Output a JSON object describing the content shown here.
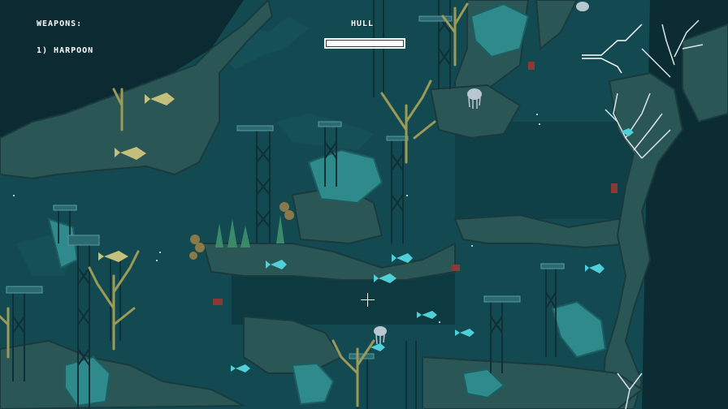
{
  "hud": {
    "weapons_label": "WEAPONS:",
    "weapons": [
      "1) HARPOON"
    ],
    "hull_label": "HULL",
    "hull_level": 1.0
  },
  "colors": {
    "water": "#134a52",
    "water_deep": "#0b3138",
    "rock": "#2a5656",
    "rock_dark": "#1a3a3d",
    "coral_yellow": "#9b9a57",
    "coral_white": "#d8e6ea",
    "fish_cyan": "#4fd0d8",
    "fish_yellow": "#c4bf7a",
    "crab_red": "#8a3a34",
    "tower": "#12393e"
  }
}
